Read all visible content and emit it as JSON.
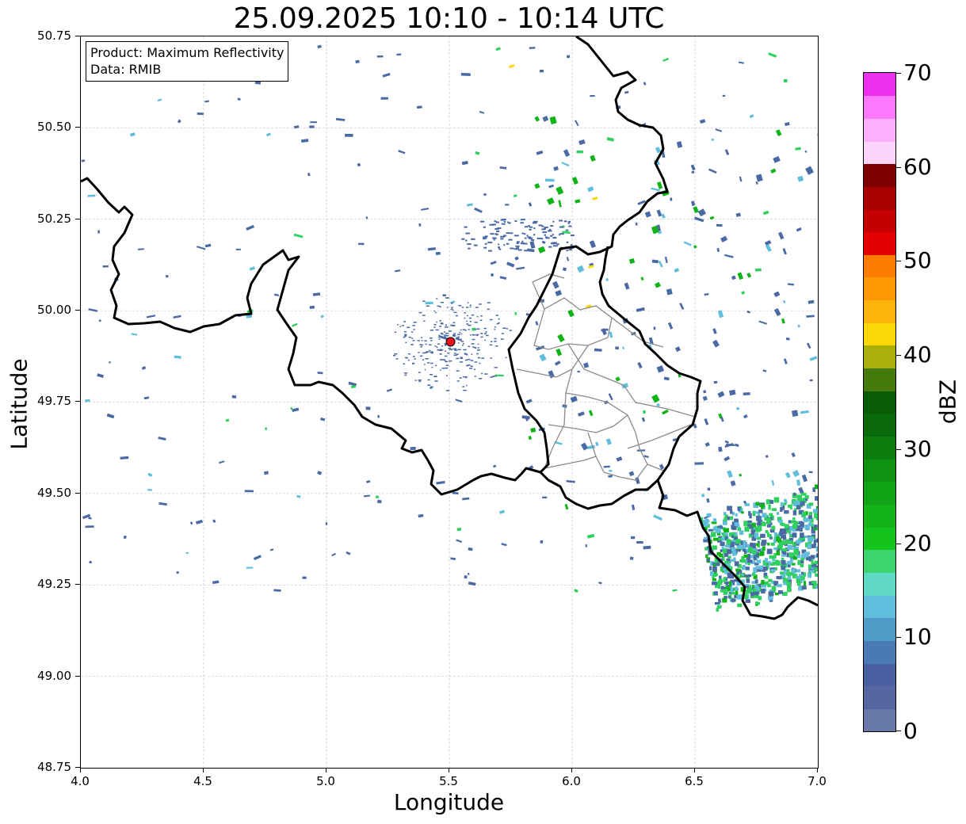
{
  "title": "25.09.2025 10:10 - 10:14 UTC",
  "info": {
    "product": "Product: Maximum Reflectivity",
    "source": "Data: RMIB"
  },
  "axes": {
    "xlabel": "Longitude",
    "ylabel": "Latitude",
    "xlim": [
      4.0,
      7.0
    ],
    "ylim": [
      48.75,
      50.75
    ],
    "xticks": [
      "4.0",
      "4.5",
      "5.0",
      "5.5",
      "6.0",
      "6.5",
      "7.0"
    ],
    "yticks": [
      "50.75",
      "50.50",
      "50.25",
      "50.00",
      "49.75",
      "49.50",
      "49.25",
      "49.00",
      "48.75"
    ],
    "grid": true
  },
  "radar_site": {
    "lon": 5.505,
    "lat": 49.915,
    "color": "#e8141c"
  },
  "colorbar": {
    "label": "dBZ",
    "ticks": [
      "0",
      "10",
      "20",
      "30",
      "40",
      "50",
      "60",
      "70"
    ],
    "range": [
      0,
      70
    ],
    "colors": [
      "#6677a8",
      "#5566a0",
      "#4a5fa0",
      "#4a7ab4",
      "#4f9bc8",
      "#60bedc",
      "#5fd8c4",
      "#3cd46c",
      "#14c41c",
      "#14b418",
      "#10a414",
      "#0e9210",
      "#0c7e0c",
      "#0a6a0a",
      "#085c08",
      "#457a0c",
      "#aab00a",
      "#fcd808",
      "#fcb408",
      "#fc9804",
      "#fc7c00",
      "#e40000",
      "#c40000",
      "#a80000",
      "#7c0000",
      "#fcd4fc",
      "#fcb0fc",
      "#fc78fc",
      "#ec30ec"
    ]
  },
  "echo_colors": {
    "weak": "#4a6aa4",
    "light": "#60bedc",
    "moderate": "#30d060",
    "strong": "#10b418",
    "intense": "#fcd808"
  }
}
